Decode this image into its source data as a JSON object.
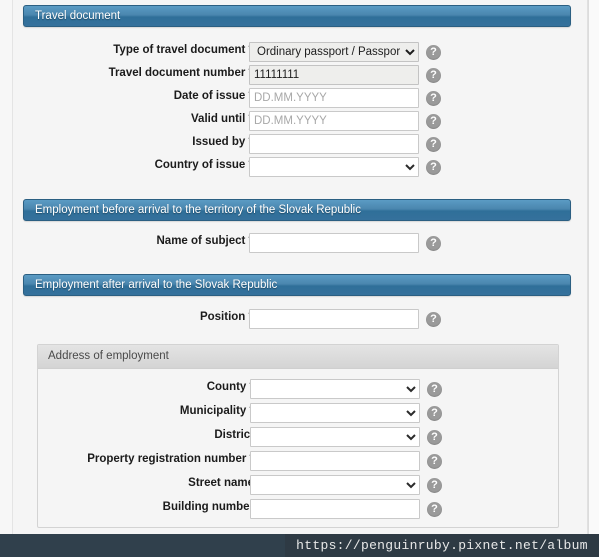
{
  "sections": [
    {
      "id": "travel-document",
      "title": "Travel document",
      "fields": [
        {
          "label": "Type of travel document",
          "required": true,
          "control": "select",
          "value": "Ordinary passport / Passport",
          "readonly": true,
          "options": [
            "Ordinary passport / Passport"
          ],
          "help": "?"
        },
        {
          "label": "Travel document number",
          "required": true,
          "control": "text",
          "value": "11111111",
          "placeholder": "",
          "readonly": true,
          "help": "?"
        },
        {
          "label": "Date of issue",
          "required": true,
          "control": "text",
          "value": "",
          "placeholder": "DD.MM.YYYY",
          "readonly": false,
          "help": "?"
        },
        {
          "label": "Valid until",
          "required": true,
          "control": "text",
          "value": "",
          "placeholder": "DD.MM.YYYY",
          "readonly": false,
          "help": "?"
        },
        {
          "label": "Issued by",
          "required": true,
          "control": "text",
          "value": "",
          "placeholder": "",
          "readonly": false,
          "help": "?"
        },
        {
          "label": "Country of issue",
          "required": true,
          "control": "select",
          "value": "",
          "readonly": false,
          "options": [
            ""
          ],
          "help": "?"
        }
      ]
    },
    {
      "id": "employment-before-arrival",
      "title": "Employment before arrival to the territory of the Slovak Republic",
      "fields": [
        {
          "label": "Name of subject",
          "required": true,
          "control": "text",
          "value": "",
          "placeholder": "",
          "readonly": false,
          "help": "?"
        }
      ]
    },
    {
      "id": "employment-after-arrival",
      "title": "Employment after arrival to the Slovak Republic",
      "fields": [
        {
          "label": "Position",
          "required": true,
          "control": "text",
          "value": "",
          "placeholder": "",
          "readonly": false,
          "help": "?"
        }
      ]
    }
  ],
  "subpanel": {
    "title": "Address of employment",
    "fields": [
      {
        "label": "County",
        "required": true,
        "control": "select",
        "value": "",
        "options": [
          ""
        ],
        "help": "?"
      },
      {
        "label": "Municipality",
        "required": true,
        "control": "select",
        "value": "",
        "options": [
          ""
        ],
        "help": "?"
      },
      {
        "label": "District",
        "required": false,
        "control": "select",
        "value": "",
        "options": [
          ""
        ],
        "help": "?"
      },
      {
        "label": "Property registration number",
        "required": true,
        "control": "text",
        "value": "",
        "placeholder": "",
        "help": "?"
      },
      {
        "label": "Street name",
        "required": false,
        "control": "select",
        "value": "",
        "options": [
          ""
        ],
        "help": "?"
      },
      {
        "label": "Building number",
        "required": false,
        "control": "text",
        "value": "",
        "placeholder": "",
        "help": "?"
      }
    ]
  },
  "watermark": {
    "url": "https://penguinruby.pixnet.net/album"
  },
  "colors": {
    "header_blue_top": "#5b9bc4",
    "header_blue_bottom": "#35719c",
    "page_background": "#f5f5f5",
    "help_icon_gray": "#9a9a9a",
    "readonly_field": "#eeeeec",
    "watermark_bar": "#2e3a44"
  }
}
